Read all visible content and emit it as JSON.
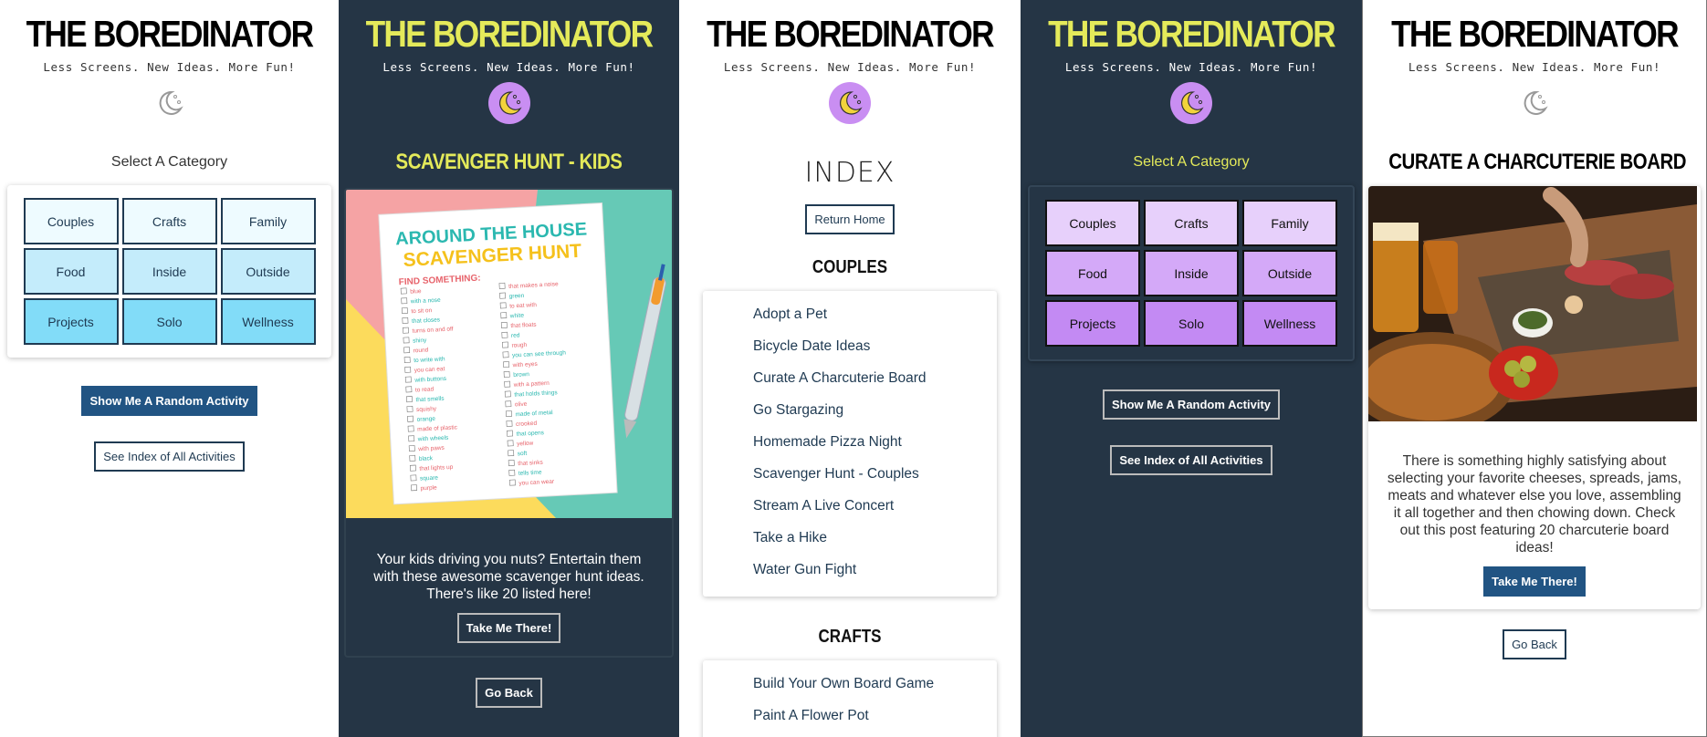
{
  "branding": {
    "title": "THE BOREDINATOR",
    "tagline": "Less Screens. New Ideas. More Fun!"
  },
  "colors": {
    "dark_bg": "#253545",
    "accent_yellow": "#e4ea5a",
    "primary_button": "#215483",
    "moon_circle": "#c98ef2",
    "light_row1": "#eefbff",
    "light_row2": "#c4ecfb",
    "light_row3": "#82dcf8",
    "dark_row1": "#e7d0fb",
    "dark_row2": "#d4a9f8",
    "dark_row3": "#c38af3"
  },
  "home": {
    "select_label": "Select A Category",
    "categories": [
      "Couples",
      "Crafts",
      "Family",
      "Food",
      "Inside",
      "Outside",
      "Projects",
      "Solo",
      "Wellness"
    ],
    "random_button": "Show Me A Random Activity",
    "index_button": "See Index of All Activities"
  },
  "kids_activity": {
    "title": "SCAVENGER HUNT - KIDS",
    "image": {
      "heading_line1": "AROUND THE HOUSE",
      "heading_line2": "SCAVENGER HUNT",
      "find_label": "FIND SOMETHING:",
      "col1": [
        "blue",
        "with a nose",
        "to sit on",
        "that closes",
        "turns on and off",
        "shiny",
        "round",
        "to write with",
        "you can eat",
        "with buttons",
        "to read",
        "that smells",
        "squishy",
        "orange",
        "made of plastic",
        "with wheels",
        "with paws",
        "black",
        "that lights up",
        "square",
        "purple"
      ],
      "col2": [
        "that makes a noise",
        "green",
        "to eat with",
        "white",
        "that floats",
        "red",
        "rough",
        "you can see through",
        "with eyes",
        "brown",
        "with a pattern",
        "that holds things",
        "olive",
        "made of metal",
        "crooked",
        "that opens",
        "yellow",
        "soft",
        "that sinks",
        "tells time",
        "you can wear"
      ]
    },
    "description": "Your kids driving you nuts? Entertain them with these awesome scavenger hunt ideas. There's like 20 listed here!",
    "go_button": "Take Me There!",
    "back_button": "Go Back"
  },
  "index": {
    "title": "INDEX",
    "return_button": "Return Home",
    "sections": [
      {
        "heading": "COUPLES",
        "items": [
          "Adopt a Pet",
          "Bicycle Date Ideas",
          "Curate A Charcuterie Board",
          "Go Stargazing",
          "Homemade Pizza Night",
          "Scavenger Hunt - Couples",
          "Stream A Live Concert",
          "Take a Hike",
          "Water Gun Fight"
        ]
      },
      {
        "heading": "CRAFTS",
        "items": [
          "Build Your Own Board Game",
          "Paint A Flower Pot"
        ]
      }
    ]
  },
  "dark_home": {
    "select_label": "Select A Category",
    "categories": [
      "Couples",
      "Crafts",
      "Family",
      "Food",
      "Inside",
      "Outside",
      "Projects",
      "Solo",
      "Wellness"
    ],
    "random_button": "Show Me A Random Activity",
    "index_button": "See Index of All Activities"
  },
  "charcuterie": {
    "title": "CURATE A CHARCUTERIE BOARD",
    "description": "There is something highly satisfying about selecting your favorite cheeses, spreads, jams, meats and whatever else you love, assembling it all together and then chowing down. Check out this post featuring 20 charcuterie board ideas!",
    "go_button": "Take Me There!",
    "back_button": "Go Back"
  }
}
